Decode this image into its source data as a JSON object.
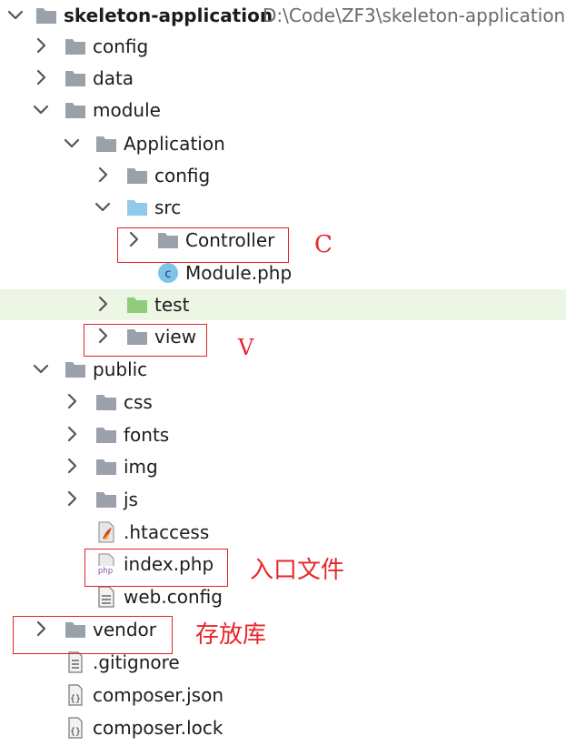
{
  "tree": {
    "root": {
      "label": "skeleton-application",
      "path": "D:\\Code\\ZF3\\skeleton-application"
    },
    "items": [
      {
        "label": "config",
        "name": "config-folder"
      },
      {
        "label": "data",
        "name": "data-folder"
      },
      {
        "label": "module",
        "name": "module-folder"
      },
      {
        "label": "Application",
        "name": "application-folder"
      },
      {
        "label": "config",
        "name": "application-config-folder"
      },
      {
        "label": "src",
        "name": "src-folder"
      },
      {
        "label": "Controller",
        "name": "controller-folder"
      },
      {
        "label": "Module.php",
        "name": "module-php-file"
      },
      {
        "label": "test",
        "name": "test-folder"
      },
      {
        "label": "view",
        "name": "view-folder"
      },
      {
        "label": "public",
        "name": "public-folder"
      },
      {
        "label": "css",
        "name": "css-folder"
      },
      {
        "label": "fonts",
        "name": "fonts-folder"
      },
      {
        "label": "img",
        "name": "img-folder"
      },
      {
        "label": "js",
        "name": "js-folder"
      },
      {
        "label": ".htaccess",
        "name": "htaccess-file"
      },
      {
        "label": "index.php",
        "name": "index-php-file"
      },
      {
        "label": "web.config",
        "name": "web-config-file"
      },
      {
        "label": "vendor",
        "name": "vendor-folder"
      },
      {
        "label": ".gitignore",
        "name": "gitignore-file"
      },
      {
        "label": "composer.json",
        "name": "composer-json-file"
      },
      {
        "label": "composer.lock",
        "name": "composer-lock-file"
      }
    ]
  },
  "annotations": {
    "controller": "C",
    "view": "V",
    "index": "入口文件",
    "vendor": "存放库"
  },
  "colors": {
    "folder": "#9aa1ab",
    "folder_src": "#8fc9ec",
    "folder_test": "#8fcd7a",
    "highlight_row": "#edf5e5",
    "annotation": "#e8262a",
    "php_badge": "#7b4fa8"
  }
}
